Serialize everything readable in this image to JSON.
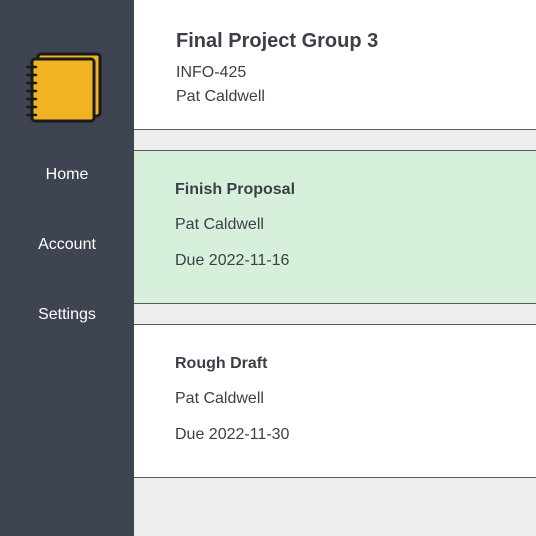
{
  "sidebar": {
    "logo_icon": "notebook-icon",
    "logo_color": "#f0b323",
    "items": [
      {
        "label": "Home"
      },
      {
        "label": "Account"
      },
      {
        "label": "Settings"
      }
    ]
  },
  "header": {
    "title": "Final Project Group 3",
    "course": "INFO-425",
    "owner": "Pat Caldwell"
  },
  "tasks": [
    {
      "title": "Finish Proposal",
      "assignee": "Pat Caldwell",
      "due": "Due 2022-11-16",
      "highlight_color": "#d6f0dc"
    },
    {
      "title": "Rough Draft",
      "assignee": "Pat Caldwell",
      "due": "Due 2022-11-30",
      "highlight_color": "#ffffff"
    }
  ],
  "colors": {
    "sidebar": "#3e4451",
    "background": "#ededed",
    "text": "#3b3f47"
  }
}
